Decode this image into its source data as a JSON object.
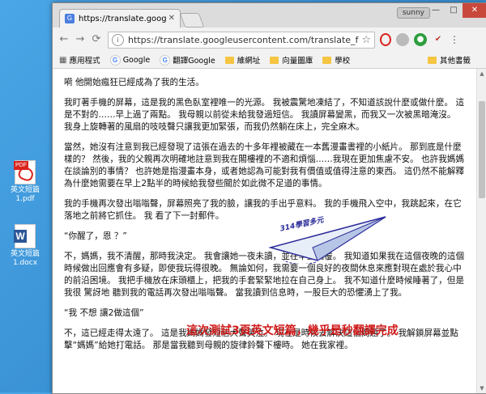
{
  "desktop": {
    "icons": [
      {
        "label": "英文短篇\n1.pdf",
        "line1": "英文短篇",
        "line2": "1.pdf",
        "badge": "PDF"
      },
      {
        "label": "英文短篇\n1.docx",
        "line1": "英文短篇",
        "line2": "1.docx",
        "badge": "W"
      }
    ]
  },
  "browser": {
    "tab": {
      "title": "https://translate.google",
      "favicon": "G"
    },
    "user": "sunny",
    "window_buttons": {
      "minimize": "—",
      "maximize": "□",
      "close": "✕"
    },
    "url": "https://translate.googleusercontent.com/translate_f",
    "bookmarks": [
      {
        "label": "應用程式",
        "icon": "apps-grid-icon"
      },
      {
        "label": "Google",
        "icon": "google-icon"
      },
      {
        "label": "翻譯Google",
        "icon": "google-icon"
      },
      {
        "label": "維網址",
        "icon": "folder-icon"
      },
      {
        "label": "向量圖庫",
        "icon": "folder-icon"
      },
      {
        "label": "學校",
        "icon": "folder-icon"
      }
    ],
    "other_bookmarks": "其他書籤"
  },
  "content": {
    "paragraphs": [
      "嗬 他開始瘋狂已經成為了我的生活。",
      "我盯著手機的屏幕，這是我的黑色臥室裡唯一的光源。 我被震驚地凍結了，不知道該說什麼或做什麼。 這是不對的……早上過了兩點。 我母親以前從未給我發過短信。 我讀屏幕變黑，而我又一次被黑暗淹沒。 我身上旋轉著的風扇的吱吱聲只讓我更加緊張，而我仍然躺在床上，完全麻木。",
      "當然，她沒有注意到我已經發現了這張在過去的十多年裡被藏在一本舊漫畫書裡的小紙片。 那到底是什麼樣的？ 然後，我的父親再次明確地註意到我在閣樓裡的不適和煩惱……我現在更加焦慮不安。 也許我媽媽在談論別的事情？ 也許她是指漫畫本身，或者她認為可能對我有價值或值得注意的東西。 這仍然不能解釋為什麼她需要在早上2點半的時候給我發些關於如此微不足道的事情。",
      "我的手機再次發出嗡嗡聲，屏幕照亮了我的臉，讓我的手出乎意料。 我的手機飛入空中，我跳起來，在它落地之前將它抓住。 我 看了下一封郵件。",
      "“你醒了，恩 ？”",
      "不，媽媽，我不清醒，那時我決定。 我會讓她一夜未讀，並在早上回覆。 我知道如果我在這個夜晚的這個時候做出回應會有多疑，即使我玩得很晚。 無論如何，我需要一個良好的夜間休息來應對現在處於我心中的前沿困境。 我把手機放在床頭櫃上，把我的手套緊緊地拉在自己身上。 我不知道什麼時候睡著了，但是我很 驚訝地 聽到我的電話再次發出嗡嗡聲。 當我讀到信息時，一股巨大的恐懼湧上了我。",
      "“我 不想 讓2做這個”",
      "不，這已經走得太遠了。 這是我媽媽發短信大聲哭泣。 現在是時候去解決這個問題了。 我解鎖屏幕並點擊“媽媽”給她打電話。 那是當我聽到母親的旋律鈴聲下樓時。 她在我家裡。"
    ]
  },
  "overlay": {
    "plane_label": "314學習多元",
    "caption": "這次測試3頁英文短篇，幾乎是秒翻譯完成"
  },
  "colors": {
    "caption": "#d01a1a",
    "plane": "#2c2c9a",
    "desktop": "#3a8fd0"
  }
}
